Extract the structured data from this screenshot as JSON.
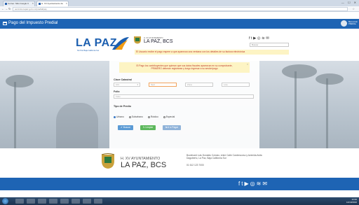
{
  "browser": {
    "tabs": [
      {
        "label": "Correo: Sitio Google C"
      },
      {
        "label": "H. XV Ayuntamiento de"
      }
    ],
    "window_controls": "— ☐ ✕",
    "url": "servicios.lapaz.gob.mx/predial/pay"
  },
  "app": {
    "title": "Pago del Impuesto Predial",
    "user_name": "Bienvenido PREDIAL"
  },
  "brand": {
    "lapaz_word": "LA PAZ",
    "lapaz_sub": "Sin Paz Baja California Sur",
    "ayto_small": "H. XV AYUNTAMIENTO",
    "ayto_big": "LA PAZ, BCS",
    "top_alert": "El Usuario recibe el pago espere a que aparezca una ventana con los detalles de su factura electrónica",
    "search_placeholder": "Buscar"
  },
  "form": {
    "notice_line1": "El Pago los contribuyentes que quieran que sus datos fiscales aparezcan en su comprobante,",
    "notice_line2": "PRIMERO deberán registrarse y luego ingresar a su sesión/pago",
    "clave_label": "Clave Catastral",
    "clave_values": [
      "101",
      "Sect",
      "Zona",
      "Lote"
    ],
    "folio_label": "Folio",
    "folio_placeholder": "Folio",
    "tipo_label": "Tipo de Predio",
    "tipo_options": [
      "Urbano",
      "Suburbano",
      "Rústico",
      "Especial"
    ],
    "tipo_selected": "Urbano",
    "btn_search": "Buscar",
    "btn_clear": "Limpiar",
    "btn_pay": "Ir a Pagar"
  },
  "footer": {
    "ayto_small": "H. XV AYUNTAMIENTO",
    "ayto_big": "LA PAZ, BCS",
    "address": "Boulevard Luis Donaldo Colosio, entre Calle Cardencurso y Avenida Avita Dagoberto, La Paz, Baja California Sur",
    "phone": "01 612 123 7000"
  },
  "social_icons": [
    "facebook-icon",
    "twitter-icon",
    "youtube-icon",
    "instagram-icon",
    "rss-icon",
    "mail-icon"
  ],
  "taskbar": {
    "time": "12:00",
    "date": "14/10/2016"
  },
  "colors": {
    "brand_blue": "#1e64b4",
    "alert_bg": "#fdf4c4",
    "alert_text": "#c0392b",
    "btn_search": "#5b9bd5",
    "btn_clear": "#5cb85c",
    "btn_pay": "#8fb3d9"
  }
}
